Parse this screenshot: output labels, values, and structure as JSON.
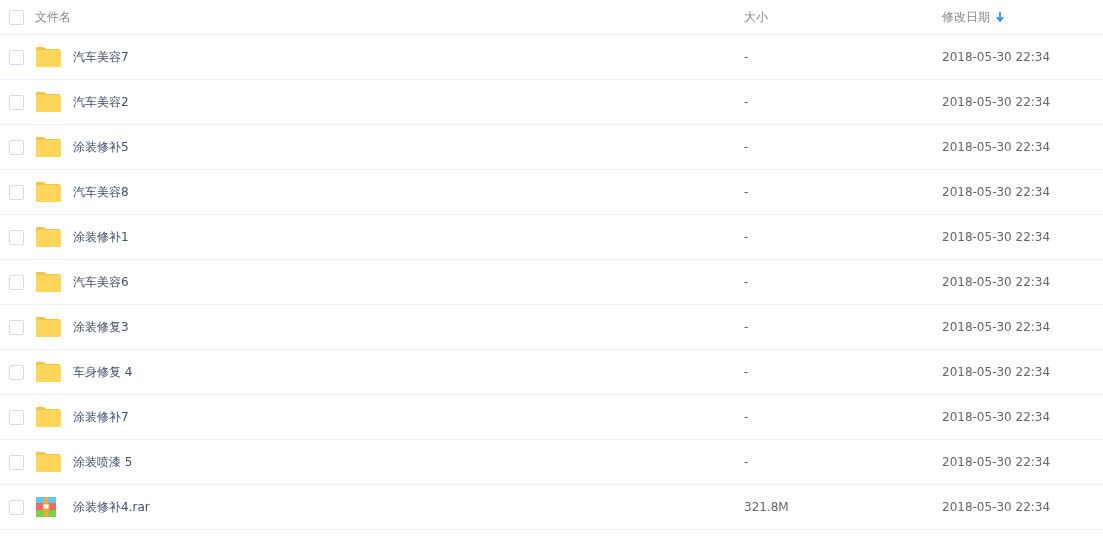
{
  "header": {
    "checked": false,
    "columns": [
      {
        "label": "文件名",
        "sorted": false
      },
      {
        "label": "大小",
        "sorted": false
      },
      {
        "label": "修改日期",
        "sorted": true
      }
    ]
  },
  "rows": [
    {
      "kind": "folder",
      "name": "汽车美容7",
      "size": "-",
      "modified": "2018-05-30 22:34",
      "checked": false
    },
    {
      "kind": "folder",
      "name": "汽车美容2",
      "size": "-",
      "modified": "2018-05-30 22:34",
      "checked": false
    },
    {
      "kind": "folder",
      "name": "涂装修补5",
      "size": "-",
      "modified": "2018-05-30 22:34",
      "checked": false
    },
    {
      "kind": "folder",
      "name": "汽车美容8",
      "size": "-",
      "modified": "2018-05-30 22:34",
      "checked": false
    },
    {
      "kind": "folder",
      "name": "涂装修补1",
      "size": "-",
      "modified": "2018-05-30 22:34",
      "checked": false
    },
    {
      "kind": "folder",
      "name": "汽车美容6",
      "size": "-",
      "modified": "2018-05-30 22:34",
      "checked": false
    },
    {
      "kind": "folder",
      "name": "涂装修复3",
      "size": "-",
      "modified": "2018-05-30 22:34",
      "checked": false
    },
    {
      "kind": "folder",
      "name": "车身修复 4",
      "size": "-",
      "modified": "2018-05-30 22:34",
      "checked": false
    },
    {
      "kind": "folder",
      "name": "涂装修补7",
      "size": "-",
      "modified": "2018-05-30 22:34",
      "checked": false
    },
    {
      "kind": "folder",
      "name": "涂装喷漆 5",
      "size": "-",
      "modified": "2018-05-30 22:34",
      "checked": false
    },
    {
      "kind": "archive",
      "name": "涂装修补4.rar",
      "size": "321.8M",
      "modified": "2018-05-30 22:34",
      "checked": false
    }
  ]
}
